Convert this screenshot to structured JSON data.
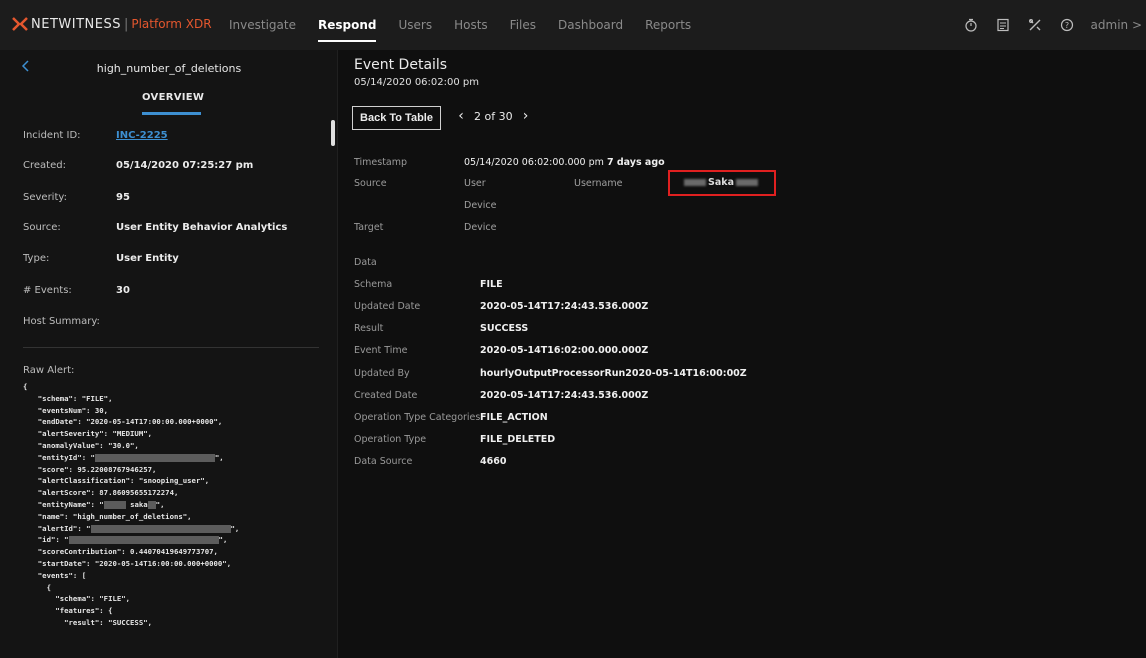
{
  "brand": {
    "name": "NETWITNESS",
    "separator": "|",
    "product": "Platform XDR",
    "accent": "#e4572e"
  },
  "nav": {
    "items": [
      "Investigate",
      "Respond",
      "Users",
      "Hosts",
      "Files",
      "Dashboard",
      "Reports"
    ],
    "active": "Respond",
    "icons": [
      "timer-icon",
      "checklist-icon",
      "tools-icon",
      "help-icon"
    ],
    "user": "admin >"
  },
  "incident": {
    "name": "high_number_of_deletions",
    "tab": "OVERVIEW",
    "fields": [
      {
        "label": "Incident ID:",
        "value": "INC-2225"
      },
      {
        "label": "Created:",
        "value": "05/14/2020 07:25:27 pm"
      },
      {
        "label": "Severity:",
        "value": "95"
      },
      {
        "label": "Source:",
        "value": "User Entity Behavior Analytics"
      },
      {
        "label": "Type:",
        "value": "User Entity"
      },
      {
        "label": "# Events:",
        "value": "30"
      },
      {
        "label": "Host Summary:",
        "value": ""
      }
    ],
    "raw_label": "Raw Alert:",
    "raw_lines": [
      "{",
      "  \"schema\": \"FILE\",",
      "  \"eventsNum\": 30,",
      "  \"endDate\": \"2020-05-14T17:00:00.000+0000\",",
      "  \"alertSeverity\": \"MEDIUM\",",
      "  \"anomalyValue\": \"30.0\",",
      "  \"entityId\": \"",
      "  \"score\": 95.22008767946257,",
      "  \"alertClassification\": \"snooping_user\",",
      "  \"alertScore\": 87.86095655172274,",
      "  \"entityName\": \"",
      "  \"name\": \"high_number_of_deletions\",",
      "  \"alertId\": \"",
      "  \"id\": \"",
      "  \"scoreContribution\": 0.44070419649773707,",
      "  \"startDate\": \"2020-05-14T16:00:00.000+0000\",",
      "  \"events\": [",
      "    {",
      "      \"schema\": \"FILE\",",
      "      \"features\": {",
      "        \"result\": \"SUCCESS\","
    ],
    "entity_name_visible": "saka"
  },
  "event": {
    "title": "Event Details",
    "time": "05/14/2020 06:02:00 pm",
    "back_label": "Back To Table",
    "pager": "2 of 30",
    "timestamp_label": "Timestamp",
    "timestamp_value": "05/14/2020 06:02:00.000 pm",
    "timestamp_ago": "7 days ago",
    "source_label": "Source",
    "source_user": "User",
    "source_device": "Device",
    "username_label": "Username",
    "username_visible": "Saka",
    "target_label": "Target",
    "target_device": "Device",
    "data_label": "Data",
    "data": [
      {
        "label": "Schema",
        "value": "FILE"
      },
      {
        "label": "Updated Date",
        "value": "2020-05-14T17:24:43.536.000Z"
      },
      {
        "label": "Result",
        "value": "SUCCESS"
      },
      {
        "label": "Event Time",
        "value": "2020-05-14T16:02:00.000.000Z"
      },
      {
        "label": "Updated By",
        "value": "hourlyOutputProcessorRun2020-05-14T16:00:00Z"
      },
      {
        "label": "Created Date",
        "value": "2020-05-14T17:24:43.536.000Z"
      },
      {
        "label": "Operation Type Categories",
        "value": "FILE_ACTION"
      },
      {
        "label": "Operation Type",
        "value": "FILE_DELETED"
      },
      {
        "label": "Data Source",
        "value": "4660"
      }
    ],
    "highlight_color": "#e02020"
  }
}
